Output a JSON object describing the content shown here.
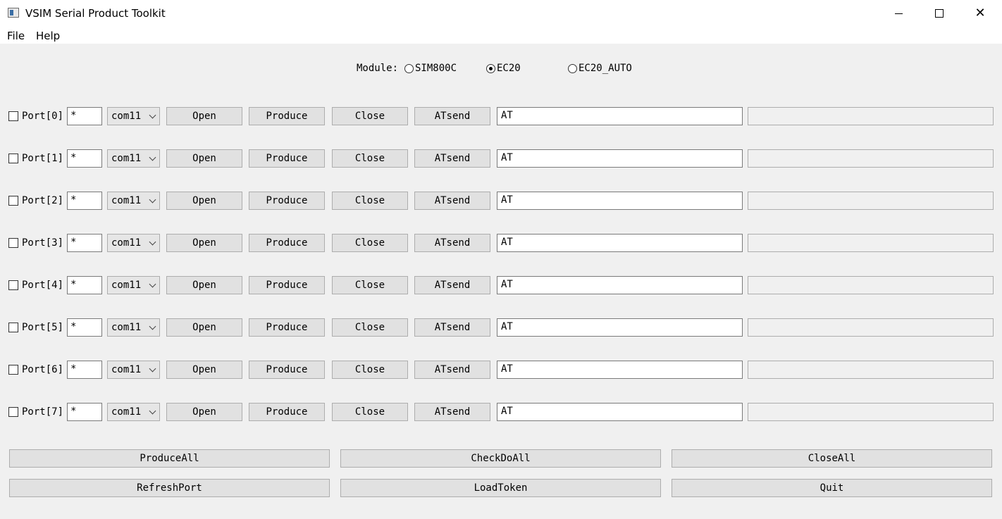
{
  "window": {
    "title": "VSIM Serial Product Toolkit",
    "icon": "app-window-icon",
    "controls": [
      "minimize-icon",
      "maximize-icon",
      "close-icon"
    ]
  },
  "menu": {
    "file": "File",
    "help": "Help"
  },
  "module": {
    "label": "Module:",
    "options": [
      {
        "label": "SIM800C",
        "checked": false
      },
      {
        "label": "EC20",
        "checked": true
      },
      {
        "label": "EC20_AUTO",
        "checked": false
      }
    ]
  },
  "ports": [
    {
      "label": "Port[0]",
      "checked": false,
      "filter": "*",
      "com": "com11",
      "open": "Open",
      "produce": "Produce",
      "close": "Close",
      "atsend": "ATsend",
      "command": "AT",
      "response": ""
    },
    {
      "label": "Port[1]",
      "checked": false,
      "filter": "*",
      "com": "com11",
      "open": "Open",
      "produce": "Produce",
      "close": "Close",
      "atsend": "ATsend",
      "command": "AT",
      "response": ""
    },
    {
      "label": "Port[2]",
      "checked": false,
      "filter": "*",
      "com": "com11",
      "open": "Open",
      "produce": "Produce",
      "close": "Close",
      "atsend": "ATsend",
      "command": "AT",
      "response": ""
    },
    {
      "label": "Port[3]",
      "checked": false,
      "filter": "*",
      "com": "com11",
      "open": "Open",
      "produce": "Produce",
      "close": "Close",
      "atsend": "ATsend",
      "command": "AT",
      "response": ""
    },
    {
      "label": "Port[4]",
      "checked": false,
      "filter": "*",
      "com": "com11",
      "open": "Open",
      "produce": "Produce",
      "close": "Close",
      "atsend": "ATsend",
      "command": "AT",
      "response": ""
    },
    {
      "label": "Port[5]",
      "checked": false,
      "filter": "*",
      "com": "com11",
      "open": "Open",
      "produce": "Produce",
      "close": "Close",
      "atsend": "ATsend",
      "command": "AT",
      "response": ""
    },
    {
      "label": "Port[6]",
      "checked": false,
      "filter": "*",
      "com": "com11",
      "open": "Open",
      "produce": "Produce",
      "close": "Close",
      "atsend": "ATsend",
      "command": "AT",
      "response": ""
    },
    {
      "label": "Port[7]",
      "checked": false,
      "filter": "*",
      "com": "com11",
      "open": "Open",
      "produce": "Produce",
      "close": "Close",
      "atsend": "ATsend",
      "command": "AT",
      "response": ""
    }
  ],
  "actions": {
    "produce_all": "ProduceAll",
    "check_do_all": "CheckDoAll",
    "close_all": "CloseAll",
    "refresh_port": "RefreshPort",
    "load_token": "LoadToken",
    "quit": "Quit"
  }
}
